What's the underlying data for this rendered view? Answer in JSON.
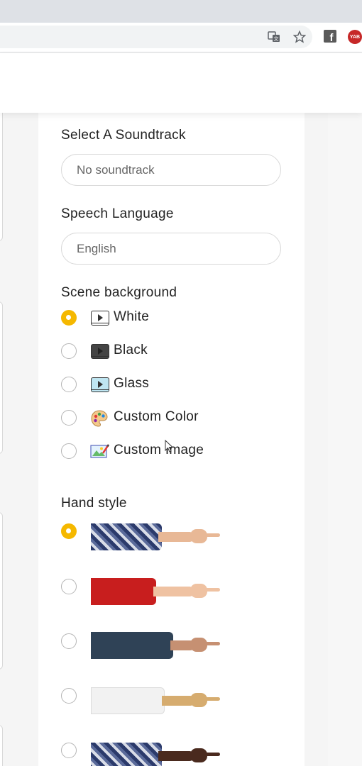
{
  "browser": {
    "translate_icon": "translate-icon",
    "bookmark_icon": "star-icon",
    "extensions": [
      {
        "name": "facebook-extension-icon",
        "label": "f"
      },
      {
        "name": "yab-extension-icon",
        "label": "YAB"
      }
    ]
  },
  "colors": {
    "accent": "#f5b800",
    "panel_bg": "#ffffff",
    "page_bg": "#f5f5f5",
    "border": "#d9d9d9"
  },
  "soundtrack": {
    "label": "Select A Soundtrack",
    "value": "No soundtrack"
  },
  "speech": {
    "label": "Speech Language",
    "value": "English"
  },
  "scene_background": {
    "label": "Scene background",
    "options": [
      {
        "label": "White",
        "icon": "white-video-icon",
        "selected": true
      },
      {
        "label": "Black",
        "icon": "black-video-icon",
        "selected": false
      },
      {
        "label": "Glass",
        "icon": "glass-video-icon",
        "selected": false
      },
      {
        "label": "Custom Color",
        "icon": "palette-icon",
        "selected": false
      },
      {
        "label": "Custom Image",
        "icon": "image-edit-icon",
        "selected": false
      }
    ]
  },
  "hand_style": {
    "label": "Hand style",
    "options": [
      {
        "sleeve": "navy-floral",
        "skin": "light",
        "selected": true
      },
      {
        "sleeve": "red",
        "skin": "light",
        "selected": false
      },
      {
        "sleeve": "denim",
        "skin": "medium",
        "selected": false
      },
      {
        "sleeve": "white",
        "skin": "tan",
        "selected": false
      },
      {
        "sleeve": "navy-floral",
        "skin": "dark",
        "selected": false
      }
    ]
  }
}
